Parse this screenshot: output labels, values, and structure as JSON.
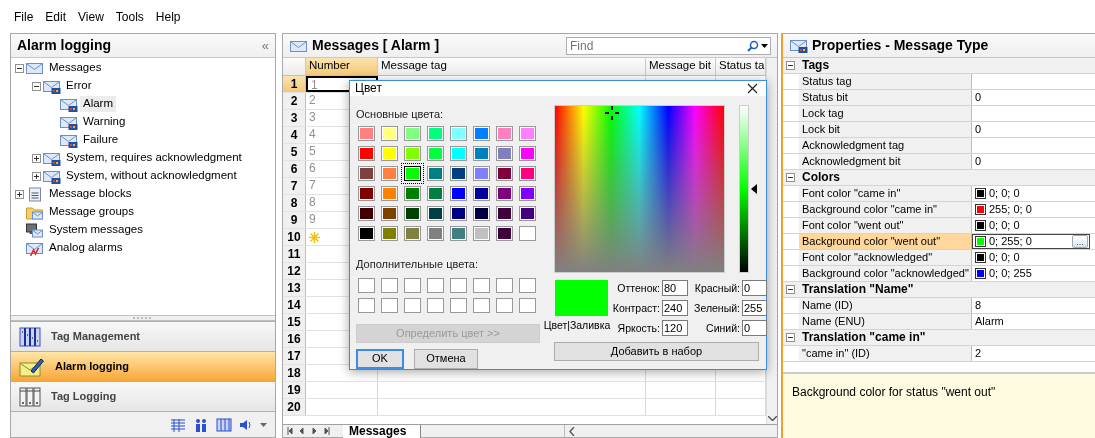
{
  "menu": [
    {
      "label": "File"
    },
    {
      "label": "Edit"
    },
    {
      "label": "View"
    },
    {
      "label": "Tools"
    },
    {
      "label": "Help"
    }
  ],
  "navigator": {
    "title": "Alarm logging",
    "collapse": "«",
    "tree": [
      {
        "label": "Messages",
        "kind": "message",
        "expanded": true,
        "selected": false,
        "children": [
          {
            "label": "Error",
            "kind": "message_type",
            "expanded": true,
            "selected": false,
            "children": [
              {
                "label": "Alarm",
                "kind": "message_type",
                "selected": true
              },
              {
                "label": "Warning",
                "kind": "message_type",
                "selected": false
              },
              {
                "label": "Failure",
                "kind": "message_type",
                "selected": false
              }
            ]
          },
          {
            "label": "System, requires acknowledgment",
            "kind": "message_type",
            "expanded": false,
            "selected": false
          },
          {
            "label": "System, without acknowledgment",
            "kind": "message_type",
            "expanded": false,
            "selected": false
          }
        ]
      },
      {
        "label": "Message blocks",
        "kind": "block",
        "expanded": false,
        "selected": false
      },
      {
        "label": "Message groups",
        "kind": "group",
        "selected": false
      },
      {
        "label": "System messages",
        "kind": "system",
        "selected": false
      },
      {
        "label": "Analog alarms",
        "kind": "analog",
        "selected": false
      }
    ],
    "editors": [
      {
        "label": "Tag Management",
        "kind": "tags",
        "selected": false
      },
      {
        "label": "Alarm logging",
        "kind": "alarm",
        "selected": true
      },
      {
        "label": "Tag Logging",
        "kind": "logging",
        "selected": false
      }
    ]
  },
  "messages": {
    "title": "Messages [ Alarm ]",
    "search": {
      "placeholder": "Find"
    },
    "columns": [
      {
        "label": "Number",
        "selected": true
      },
      {
        "label": "Message tag",
        "selected": false
      },
      {
        "label": "Message bit",
        "selected": false
      },
      {
        "label": "Status ta",
        "selected": false
      }
    ],
    "rows": [
      {
        "header": "1",
        "number": "1",
        "kind": "data",
        "selected": true
      },
      {
        "header": "2",
        "number": "2",
        "kind": "data",
        "selected": false
      },
      {
        "header": "3",
        "number": "3",
        "kind": "data",
        "selected": false
      },
      {
        "header": "4",
        "number": "4",
        "kind": "data",
        "selected": false
      },
      {
        "header": "5",
        "number": "5",
        "kind": "data",
        "selected": false
      },
      {
        "header": "6",
        "number": "6",
        "kind": "data",
        "selected": false
      },
      {
        "header": "7",
        "number": "7",
        "kind": "data",
        "selected": false
      },
      {
        "header": "8",
        "number": "8",
        "kind": "data",
        "selected": false
      },
      {
        "header": "9",
        "number": "9",
        "kind": "data",
        "selected": false
      },
      {
        "header": "10",
        "kind": "new",
        "selected": false
      },
      {
        "header": "11",
        "kind": "empty",
        "selected": false
      },
      {
        "header": "12",
        "kind": "empty",
        "selected": false
      },
      {
        "header": "13",
        "kind": "empty",
        "selected": false
      },
      {
        "header": "14",
        "kind": "empty",
        "selected": false
      },
      {
        "header": "15",
        "kind": "empty",
        "selected": false
      },
      {
        "header": "16",
        "kind": "empty",
        "selected": false
      },
      {
        "header": "17",
        "kind": "empty",
        "selected": false
      },
      {
        "header": "18",
        "kind": "empty",
        "selected": false
      },
      {
        "header": "19",
        "kind": "empty",
        "selected": false
      },
      {
        "header": "20",
        "kind": "empty",
        "selected": false
      }
    ],
    "sheet_tabs": [
      {
        "label": "Messages",
        "selected": true
      }
    ]
  },
  "color_dialog": {
    "title": "Цвет",
    "basic_label": "Основные цвета:",
    "basic_colors": [
      {
        "color": "#ff8080",
        "selected": false
      },
      {
        "color": "#ffff80",
        "selected": false
      },
      {
        "color": "#80ff80",
        "selected": false
      },
      {
        "color": "#00ff80",
        "selected": false
      },
      {
        "color": "#80ffff",
        "selected": false
      },
      {
        "color": "#0080ff",
        "selected": false
      },
      {
        "color": "#ff80c0",
        "selected": false
      },
      {
        "color": "#ff80ff",
        "selected": false
      },
      {
        "color": "#ff0000",
        "selected": false
      },
      {
        "color": "#ffff00",
        "selected": false
      },
      {
        "color": "#80ff00",
        "selected": false
      },
      {
        "color": "#00ff40",
        "selected": false
      },
      {
        "color": "#00ffff",
        "selected": false
      },
      {
        "color": "#0080c0",
        "selected": false
      },
      {
        "color": "#8080c0",
        "selected": false
      },
      {
        "color": "#ff00ff",
        "selected": false
      },
      {
        "color": "#804040",
        "selected": false
      },
      {
        "color": "#ff8040",
        "selected": false
      },
      {
        "color": "#00ff00",
        "selected": true
      },
      {
        "color": "#008080",
        "selected": false
      },
      {
        "color": "#004080",
        "selected": false
      },
      {
        "color": "#8080ff",
        "selected": false
      },
      {
        "color": "#800040",
        "selected": false
      },
      {
        "color": "#ff0080",
        "selected": false
      },
      {
        "color": "#800000",
        "selected": false
      },
      {
        "color": "#ff8000",
        "selected": false
      },
      {
        "color": "#008000",
        "selected": false
      },
      {
        "color": "#008040",
        "selected": false
      },
      {
        "color": "#0000ff",
        "selected": false
      },
      {
        "color": "#0000a0",
        "selected": false
      },
      {
        "color": "#800080",
        "selected": false
      },
      {
        "color": "#8000ff",
        "selected": false
      },
      {
        "color": "#400000",
        "selected": false
      },
      {
        "color": "#804000",
        "selected": false
      },
      {
        "color": "#004000",
        "selected": false
      },
      {
        "color": "#004040",
        "selected": false
      },
      {
        "color": "#000080",
        "selected": false
      },
      {
        "color": "#000040",
        "selected": false
      },
      {
        "color": "#400040",
        "selected": false
      },
      {
        "color": "#400080",
        "selected": false
      },
      {
        "color": "#000000",
        "selected": false
      },
      {
        "color": "#808000",
        "selected": false
      },
      {
        "color": "#808040",
        "selected": false
      },
      {
        "color": "#808080",
        "selected": false
      },
      {
        "color": "#408080",
        "selected": false
      },
      {
        "color": "#c0c0c0",
        "selected": false
      },
      {
        "color": "#400040",
        "selected": false
      },
      {
        "color": "#ffffff",
        "selected": false
      }
    ],
    "custom_label": "Дополнительные цвета:",
    "custom_colors": [
      {
        "color": "#ffffff"
      },
      {
        "color": "#ffffff"
      },
      {
        "color": "#ffffff"
      },
      {
        "color": "#ffffff"
      },
      {
        "color": "#ffffff"
      },
      {
        "color": "#ffffff"
      },
      {
        "color": "#ffffff"
      },
      {
        "color": "#ffffff"
      },
      {
        "color": "#ffffff"
      },
      {
        "color": "#ffffff"
      },
      {
        "color": "#ffffff"
      },
      {
        "color": "#ffffff"
      },
      {
        "color": "#ffffff"
      },
      {
        "color": "#ffffff"
      },
      {
        "color": "#ffffff"
      },
      {
        "color": "#ffffff"
      }
    ],
    "define_button": {
      "label": "Определить цвет >>",
      "disabled": true
    },
    "ok_button": "OK",
    "cancel_button": "Отмена",
    "preview": {
      "color": "#00ff00",
      "label": "Цвет|Заливка"
    },
    "fields": [
      {
        "label": "Оттенок:",
        "value": "80"
      },
      {
        "label": "Контраст:",
        "value": "240"
      },
      {
        "label": "Яркость:",
        "value": "120"
      },
      {
        "label": "Красный:",
        "value": "0"
      },
      {
        "label": "Зеленый:",
        "value": "255"
      },
      {
        "label": "Синий:",
        "value": "0"
      }
    ],
    "add_button": "Добавить в набор"
  },
  "properties": {
    "title": "Properties - Message Type",
    "groups": [
      {
        "label": "Tags",
        "expanded": true,
        "rows": [
          {
            "name": "Status tag",
            "selected": false
          },
          {
            "name": "Status bit",
            "value": "0",
            "selected": false
          },
          {
            "name": "Lock tag",
            "selected": false
          },
          {
            "name": "Lock bit",
            "value": "0",
            "selected": false
          },
          {
            "name": "Acknowledgment tag",
            "selected": false
          },
          {
            "name": "Acknowledgment bit",
            "value": "0",
            "selected": false
          }
        ]
      },
      {
        "label": "Colors",
        "expanded": true,
        "rows": [
          {
            "name": "Font color \"came in\"",
            "value": "0; 0; 0",
            "color": "#000000",
            "selected": false
          },
          {
            "name": "Background color \"came in\"",
            "value": "255; 0; 0",
            "color": "#ff0000",
            "selected": false
          },
          {
            "name": "Font color \"went out\"",
            "value": "0; 0; 0",
            "color": "#000000",
            "selected": false
          },
          {
            "name": "Background color \"went out\"",
            "value": "0; 255; 0",
            "color": "#00ff00",
            "selected": true,
            "action": "..."
          },
          {
            "name": "Font color \"acknowledged\"",
            "value": "0; 0; 0",
            "color": "#000000",
            "selected": false
          },
          {
            "name": "Background color \"acknowledged\"",
            "value": "0; 0; 255",
            "color": "#0000ff",
            "selected": false
          }
        ]
      },
      {
        "label": "Translation \"Name\"",
        "expanded": true,
        "rows": [
          {
            "name": "Name (ID)",
            "value": "8",
            "selected": false
          },
          {
            "name": "Name (ENU)",
            "value": "Alarm",
            "selected": false
          }
        ]
      },
      {
        "label": "Translation \"came in\"",
        "expanded": true,
        "rows": [
          {
            "name": "\"came in\" (ID)",
            "value": "2",
            "selected": false
          }
        ]
      }
    ],
    "description": "Background color for status \"went out\""
  }
}
